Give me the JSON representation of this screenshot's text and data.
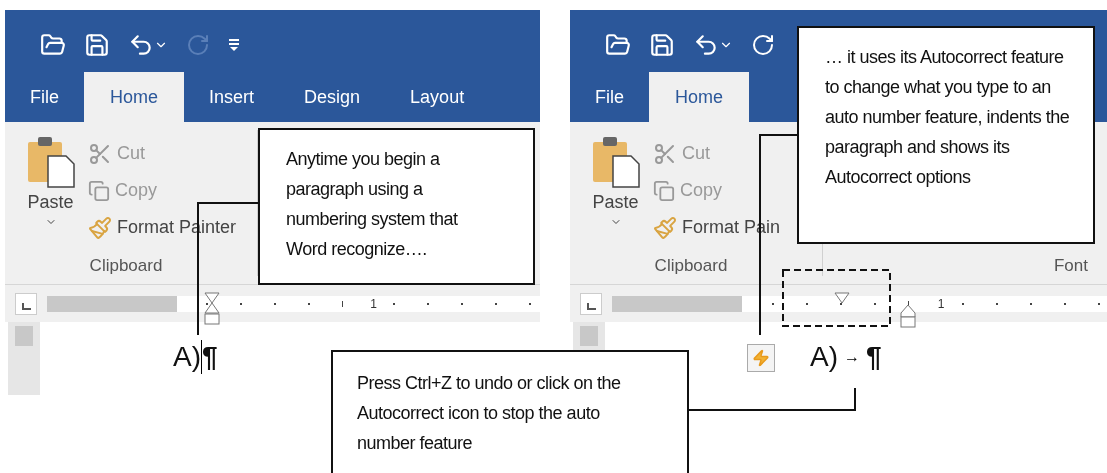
{
  "panels": [
    {
      "redo_disabled": true,
      "customize_visible": true,
      "tabs": [
        {
          "label": "File",
          "selected": false
        },
        {
          "label": "Home",
          "selected": true
        },
        {
          "label": "Insert",
          "selected": false
        },
        {
          "label": "Design",
          "selected": false
        },
        {
          "label": "Layout",
          "selected": false
        }
      ],
      "clipboard": {
        "paste": "Paste",
        "cut": "Cut",
        "copy": "Copy",
        "format_painter": "Format Painter",
        "label": "Clipboard"
      },
      "ruler": {
        "mark": "1",
        "hanging_indent": false
      },
      "document": {
        "number": "A)",
        "cursor": true,
        "autocorrect_options": false,
        "pilcrow": "¶"
      }
    },
    {
      "redo_disabled": false,
      "customize_visible": false,
      "tabs": [
        {
          "label": "File",
          "selected": false
        },
        {
          "label": "Home",
          "selected": true
        }
      ],
      "clipboard": {
        "paste": "Paste",
        "cut": "Cut",
        "copy": "Copy",
        "format_painter": "Format Pain",
        "label": "Clipboard"
      },
      "next_group_label": "Font",
      "ruler": {
        "mark": "1",
        "hanging_indent": true
      },
      "document": {
        "number": "A)",
        "cursor": false,
        "autocorrect_options": true,
        "tab_mark": "→",
        "pilcrow": "¶"
      }
    }
  ],
  "callouts": [
    {
      "text": "Anytime you begin a paragraph using a numbering system that Word recognize…."
    },
    {
      "text": "… it uses its Autocorrect feature to change what you type to an auto number feature, indents the paragraph and shows its Autocorrect options"
    },
    {
      "text": "Press Ctrl+Z to undo or click on the Autocorrect icon to stop the auto number feature"
    }
  ]
}
